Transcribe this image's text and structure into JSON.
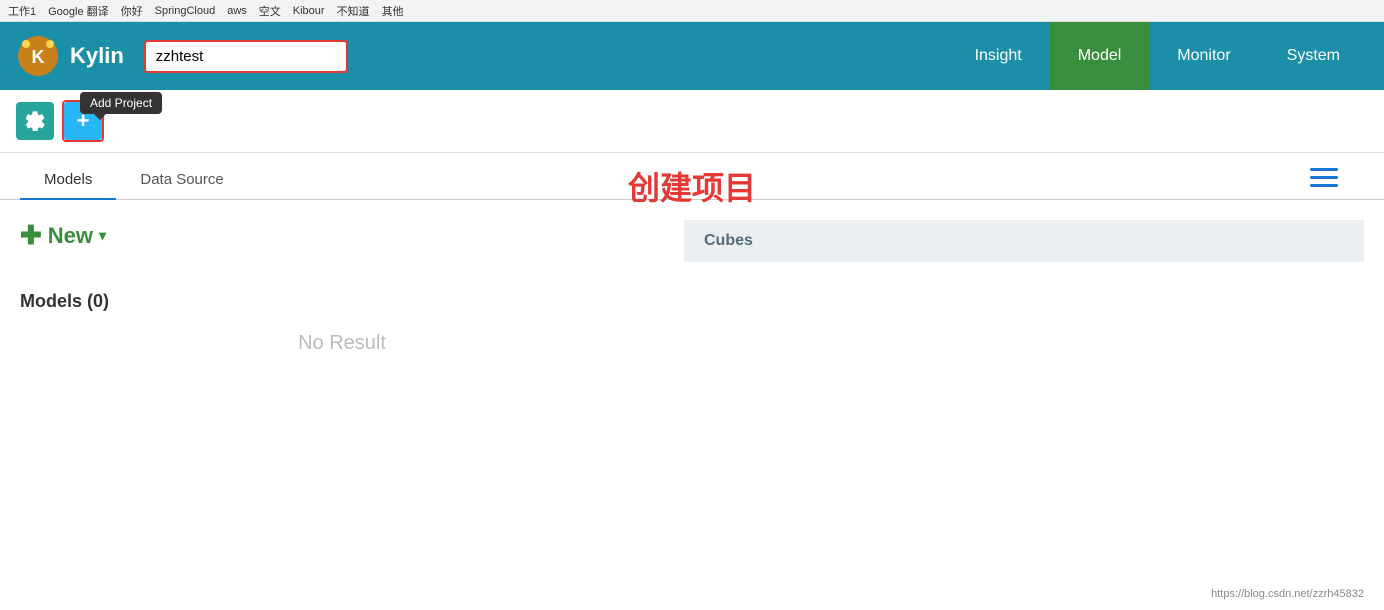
{
  "bookmarks": {
    "items": [
      "工作1",
      "Google 翻译",
      "你好",
      "SpringCloud",
      "aws",
      "空文",
      "Kibour",
      "不知道",
      "其他"
    ]
  },
  "navbar": {
    "brand": "Kylin",
    "project_input_value": "zzhtest",
    "nav_items": [
      {
        "label": "Insight",
        "state": "insight"
      },
      {
        "label": "Model",
        "state": "model"
      },
      {
        "label": "Monitor",
        "state": ""
      },
      {
        "label": "System",
        "state": ""
      }
    ]
  },
  "toolbar": {
    "tooltip": "Add Project",
    "add_button_label": "+"
  },
  "tabs": {
    "items": [
      {
        "label": "Models",
        "active": true
      },
      {
        "label": "Data Source",
        "active": false
      }
    ],
    "create_project_label": "创建项目"
  },
  "new_button": {
    "label": "New"
  },
  "cubes": {
    "header": "Cubes"
  },
  "models": {
    "count_label": "Models (0)"
  },
  "no_result": {
    "label": "No Result"
  },
  "url": "https://blog.csdn.net/zzrh45832"
}
